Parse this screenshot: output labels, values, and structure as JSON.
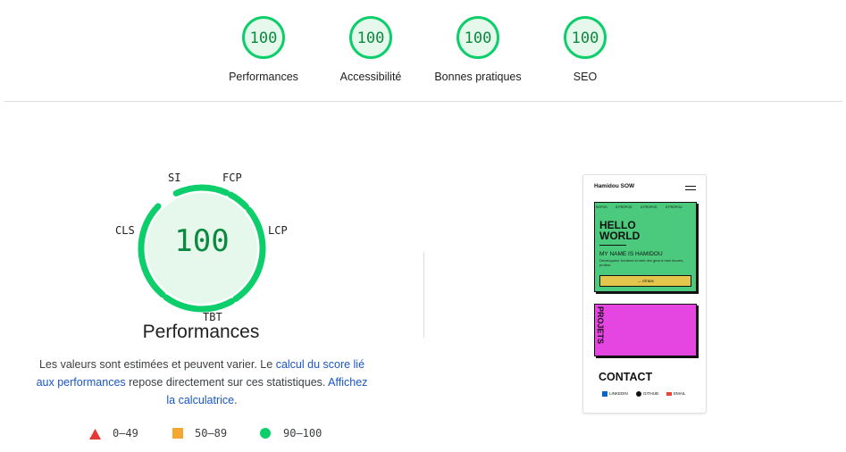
{
  "categories": [
    {
      "label": "Performances",
      "score": "100"
    },
    {
      "label": "Accessibilité",
      "score": "100"
    },
    {
      "label": "Bonnes pratiques",
      "score": "100"
    },
    {
      "label": "SEO",
      "score": "100"
    }
  ],
  "main_gauge": {
    "score": "100",
    "title": "Performances",
    "metrics": {
      "si": "SI",
      "fcp": "FCP",
      "lcp": "LCP",
      "tbt": "TBT",
      "cls": "CLS"
    }
  },
  "description": {
    "text1": "Les valeurs sont estimées et peuvent varier. Le ",
    "link1": "calcul du score lié aux performances",
    "text2": " repose directement sur ces statistiques. ",
    "link2": "Affichez la calculatrice",
    "text3": "."
  },
  "legend": [
    {
      "range": "0–49",
      "color": "#e53935"
    },
    {
      "range": "50–89",
      "color": "#f4a832"
    },
    {
      "range": "90–100",
      "color": "#0cce6b"
    }
  ],
  "colors": {
    "pass": "#0cce6b",
    "pass_text": "#0a8a3f",
    "pass_bg": "#e6f8ec"
  },
  "screenshot": {
    "brand": "Hamidou SOW",
    "nav": [
      "ROPOS",
      "À PROPOS",
      "À PROPOS",
      "À PROPOU"
    ],
    "hello": "HELLO",
    "world": "WORLD",
    "name": "MY NAME IS HAMIDOU",
    "sub": "Développeur frontend et web dev gear à mes heures, profeur",
    "button": "→ n'intos",
    "projets": "PROJETS",
    "contact": "CONTACT",
    "links": [
      "LINKEDIN",
      "GITHUB",
      "EMAIL"
    ]
  }
}
